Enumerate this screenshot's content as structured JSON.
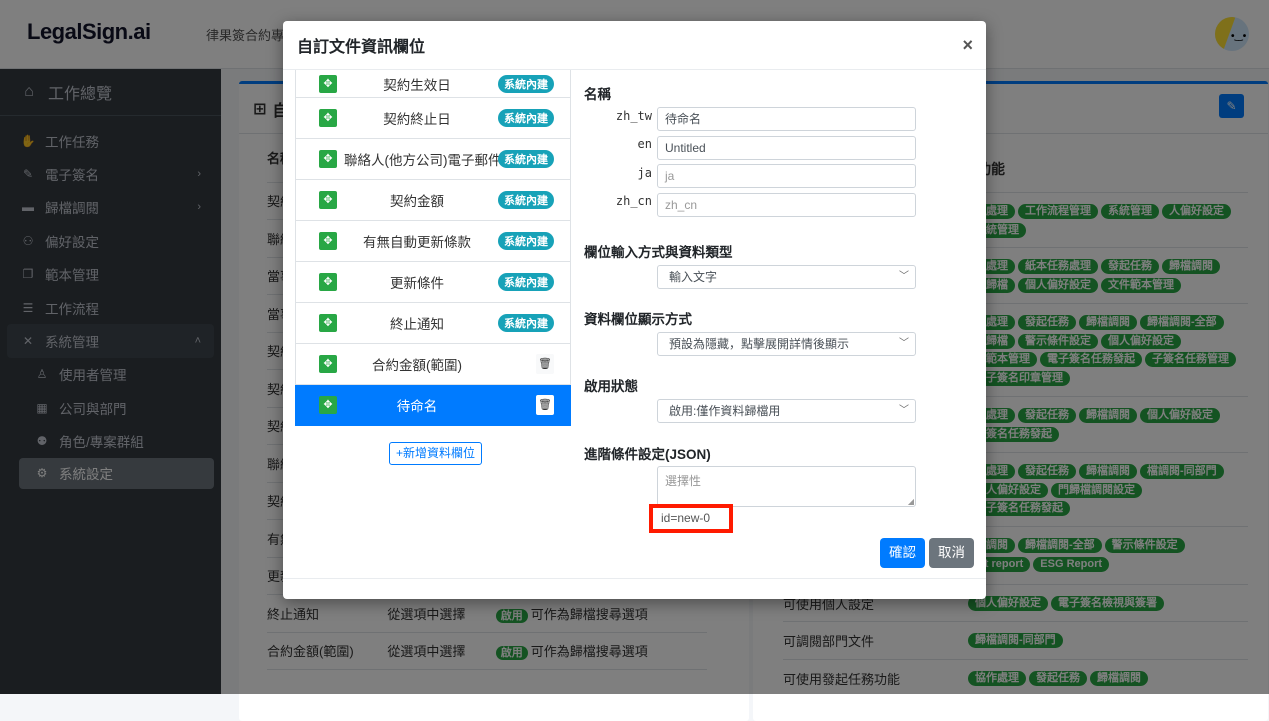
{
  "header": {
    "logo": "LegalSign.ai",
    "org_name": "律果簽合約專案",
    "avatar_face": "•‿•"
  },
  "sidebar": {
    "home": {
      "label": "工作總覽",
      "icon": "home-icon"
    },
    "items": [
      {
        "label": "工作任務",
        "icon": "handshake-icon"
      },
      {
        "label": "電子簽名",
        "icon": "signature-icon",
        "chevron": "›"
      },
      {
        "label": "歸檔調閱",
        "icon": "archive-icon",
        "chevron": "›"
      },
      {
        "label": "偏好設定",
        "icon": "user-cog-icon"
      },
      {
        "label": "範本管理",
        "icon": "copy-icon"
      },
      {
        "label": "工作流程",
        "icon": "list-check-icon"
      },
      {
        "label": "系統管理",
        "icon": "tools-icon",
        "chevron": "˄"
      }
    ],
    "subitems": [
      {
        "label": "使用者管理",
        "icon": "user-icon"
      },
      {
        "label": "公司與部門",
        "icon": "building-icon"
      },
      {
        "label": "角色/專案群組",
        "icon": "users-icon"
      },
      {
        "label": "系統設定",
        "icon": "gear-icon"
      }
    ]
  },
  "background": {
    "left_card": {
      "title": "自訂文件資訊欄位",
      "col_name": "名稱",
      "rows_partial": [
        "契約",
        "聯絡",
        "當事",
        "當事",
        "契約",
        "契約",
        "契約",
        "聯絡",
        "契約",
        "有無",
        "更新"
      ],
      "rows": [
        {
          "name": "終止通知",
          "type": "從選項中選擇",
          "status": "啟用",
          "desc": "可作為歸檔搜尋選項"
        },
        {
          "name": "合約金額(範圍)",
          "type": "從選項中選擇",
          "status": "啟用",
          "desc": "可作為歸檔搜尋選項"
        }
      ]
    },
    "right_card": {
      "col_header": "行功能",
      "rows": [
        {
          "label": "",
          "tags": [
            "作處理",
            "工作流程管理",
            "系統管理",
            "人偏好設定",
            "系統管理"
          ]
        },
        {
          "label": "",
          "tags": [
            "作處理",
            "紙本任務處理",
            "發起任務",
            "歸檔調閱",
            "描歸檔",
            "個人偏好設定",
            "文件範本管理"
          ]
        },
        {
          "label": "",
          "tags": [
            "作處理",
            "發起任務",
            "歸檔調閱",
            "歸檔調閱-全部",
            "描歸檔",
            "警示條件設定",
            "個人偏好設定",
            "件範本管理",
            "電子簽名任務發起",
            "子簽名任務管理",
            "電子簽名印章管理"
          ]
        },
        {
          "label": "",
          "tags": [
            "作處理",
            "發起任務",
            "歸檔調閱",
            "個人偏好設定",
            "子簽名任務發起"
          ]
        },
        {
          "label": "",
          "tags": [
            "作處理",
            "發起任務",
            "歸檔調閱",
            "檔調閱-同部門",
            "個人偏好設定",
            "門歸檔調閱設定",
            "電子簽名任務發起"
          ]
        },
        {
          "label": "",
          "tags": [
            "檔調閱",
            "歸檔調閱-全部",
            "警示條件設定",
            "uit report",
            "ESG Report"
          ]
        },
        {
          "label": "可使用個人設定",
          "tags": [
            "個人偏好設定",
            "電子簽名檢視與簽署"
          ]
        },
        {
          "label": "可調閱部門文件",
          "tags": [
            "歸檔調閱-同部門"
          ]
        },
        {
          "label": "可使用發起任務功能",
          "tags": [
            "協作處理",
            "發起任務",
            "歸檔調閱"
          ]
        }
      ]
    }
  },
  "modal": {
    "title": "自訂文件資訊欄位",
    "close": "×",
    "fields": [
      {
        "name": "契約生效日",
        "badge": "系統內建"
      },
      {
        "name": "契約終止日",
        "badge": "系統內建"
      },
      {
        "name": "聯絡人(他方公司)電子郵件",
        "badge": "系統內建"
      },
      {
        "name": "契約金額",
        "badge": "系統內建"
      },
      {
        "name": "有無自動更新條款",
        "badge": "系統內建"
      },
      {
        "name": "更新條件",
        "badge": "系統內建"
      },
      {
        "name": "終止通知",
        "badge": "系統內建"
      },
      {
        "name": "合約金額(範圍)",
        "deletable": true
      },
      {
        "name": "待命名",
        "deletable": true,
        "selected": true
      }
    ],
    "add_field_label": "+新增資料欄位",
    "form": {
      "name_section": "名稱",
      "names": [
        {
          "lang": "zh_tw",
          "value": "待命名",
          "placeholder": "zh_tw"
        },
        {
          "lang": "en",
          "value": "Untitled",
          "placeholder": "en"
        },
        {
          "lang": "ja",
          "value": "",
          "placeholder": "ja"
        },
        {
          "lang": "zh_cn",
          "value": "",
          "placeholder": "zh_cn"
        }
      ],
      "input_type_section": "欄位輸入方式與資料類型",
      "input_type_value": "輸入文字",
      "display_section": "資料欄位顯示方式",
      "display_value": "預設為隱藏，點擊展開詳情後顯示",
      "status_section": "啟用狀態",
      "status_value": "啟用:僅作資料歸檔用",
      "json_section": "進階條件設定(JSON)",
      "json_placeholder": "選擇性",
      "id_text": "id=new-0"
    },
    "confirm_label": "確認",
    "cancel_label": "取消"
  }
}
